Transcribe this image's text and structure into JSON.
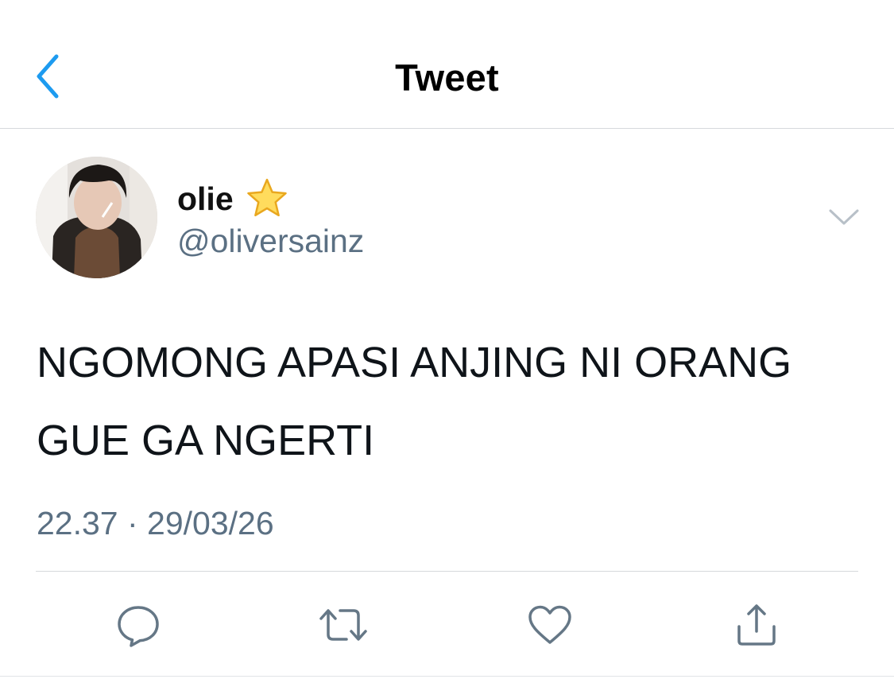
{
  "header": {
    "title": "Tweet",
    "back_icon": "chevron-left-icon",
    "accent": "#1d9bf0"
  },
  "tweet": {
    "display_name": "olie",
    "badge_icon": "star-emoji",
    "handle": "@oliversainz",
    "text_line1": "NGOMONG APASI ANJING NI ORANG",
    "text_line2": "GUE GA NGERTI",
    "timestamp": "22.37 · 29/03/26",
    "more_icon": "chevron-down-icon"
  },
  "actions": [
    {
      "name": "reply",
      "icon": "reply-icon"
    },
    {
      "name": "retweet",
      "icon": "retweet-icon"
    },
    {
      "name": "like",
      "icon": "heart-icon"
    },
    {
      "name": "share",
      "icon": "share-icon"
    }
  ],
  "colors": {
    "secondary_text": "#5b7083",
    "divider": "#d6d9dc",
    "icon_gray": "#657786"
  }
}
